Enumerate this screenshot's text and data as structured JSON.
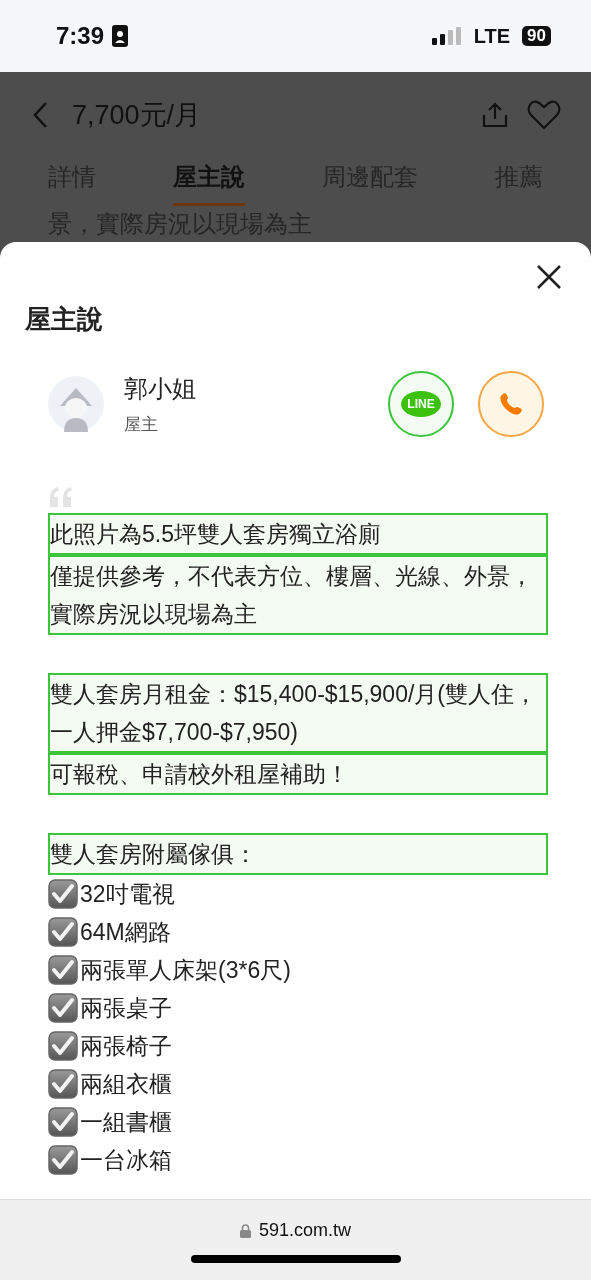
{
  "status_bar": {
    "time": "7:39",
    "network": "LTE",
    "battery": "90"
  },
  "header": {
    "title": "7,700元/月"
  },
  "tabs": [
    {
      "label": "詳情",
      "selected": false
    },
    {
      "label": "屋主說",
      "selected": true
    },
    {
      "label": "周邊配套",
      "selected": false
    },
    {
      "label": "推薦",
      "selected": false
    }
  ],
  "behind_text": "景，實際房況以現場為主",
  "sheet": {
    "title": "屋主說",
    "owner": {
      "name": "郭小姐",
      "role": "屋主"
    },
    "contact_buttons": [
      {
        "kind": "line",
        "label": "LINE"
      },
      {
        "kind": "phone"
      }
    ],
    "paragraphs": [
      [
        "此照片為5.5坪雙人套房獨立浴廁",
        "僅提供參考，不代表方位、樓層、光線、外景，實際房況以現場為主"
      ],
      [
        "雙人套房月租金：$15,400-$15,900/月(雙人住，一人押金$7,700-$7,950)",
        "可報稅、申請校外租屋補助！"
      ],
      [
        "雙人套房附屬傢俱："
      ]
    ],
    "checklist": [
      {
        "label": "32吋電視",
        "checked": true
      },
      {
        "label": "64M網路",
        "checked": true
      },
      {
        "label": "兩張單人床架(3*6尺)",
        "checked": true
      },
      {
        "label": "兩張桌子",
        "checked": true
      },
      {
        "label": "兩張椅子",
        "checked": true
      },
      {
        "label": "兩組衣櫃",
        "checked": true
      },
      {
        "label": "一組書櫃",
        "checked": true
      },
      {
        "label": "一台冰箱",
        "checked": true
      }
    ]
  },
  "browser_bar": {
    "url": "591.com.tw"
  }
}
